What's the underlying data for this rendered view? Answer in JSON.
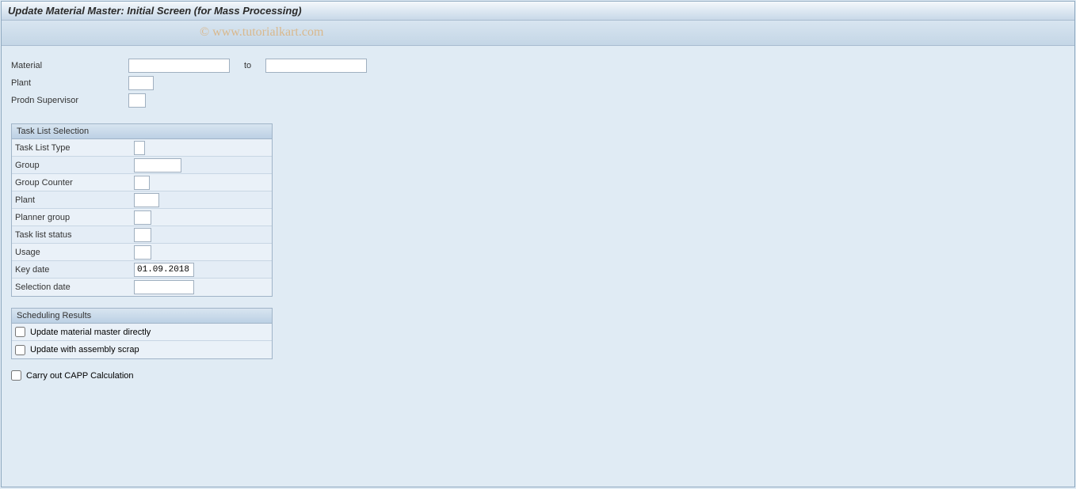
{
  "title": "Update Material Master: Initial Screen (for Mass Processing)",
  "watermark": "© www.tutorialkart.com",
  "top": {
    "material_label": "Material",
    "material_from": "",
    "to_label": "to",
    "material_to": "",
    "plant_label": "Plant",
    "plant_value": "",
    "prodn_supervisor_label": "Prodn Supervisor",
    "prodn_supervisor_value": ""
  },
  "task_list": {
    "header": "Task List Selection",
    "type_label": "Task List Type",
    "type_value": "",
    "group_label": "Group",
    "group_value": "",
    "group_counter_label": "Group Counter",
    "group_counter_value": "",
    "plant_label": "Plant",
    "plant_value": "",
    "planner_group_label": "Planner group",
    "planner_group_value": "",
    "status_label": "Task list status",
    "status_value": "",
    "usage_label": "Usage",
    "usage_value": "",
    "key_date_label": "Key date",
    "key_date_value": "01.09.2018",
    "selection_date_label": "Selection date",
    "selection_date_value": ""
  },
  "scheduling": {
    "header": "Scheduling Results",
    "update_direct_label": "Update material master directly",
    "update_scrap_label": "Update with assembly scrap"
  },
  "capp_label": "Carry out CAPP Calculation"
}
